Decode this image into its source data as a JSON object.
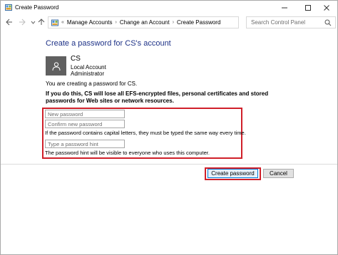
{
  "window": {
    "title": "Create Password"
  },
  "address": {
    "crumbs": [
      "Manage Accounts",
      "Change an Account",
      "Create Password"
    ],
    "overflow_glyph": "«"
  },
  "search": {
    "placeholder": "Search Control Panel"
  },
  "content": {
    "title": "Create a password for CS's account",
    "account": {
      "name": "CS",
      "type": "Local Account",
      "role": "Administrator"
    },
    "creating_note": "You are creating a password for CS.",
    "warning": "If you do this, CS will lose all EFS-encrypted files, personal certificates and stored passwords for Web sites or network resources."
  },
  "form": {
    "new_password_placeholder": "New password",
    "confirm_password_placeholder": "Confirm new password",
    "caps_note": "If the password contains capital letters, they must be typed the same way every time.",
    "hint_placeholder": "Type a password hint",
    "hint_note": "The password hint will be visible to everyone who uses this computer."
  },
  "buttons": {
    "create": "Create password",
    "cancel": "Cancel"
  },
  "colors": {
    "accent_title": "#1e3287",
    "highlight_red": "#d0202a",
    "avatar_gray": "#606060",
    "primary_button_border": "#0078d7"
  },
  "icons": {
    "app": "control-panel-icon",
    "back": "back-arrow-icon",
    "forward": "forward-arrow-icon",
    "recent": "chevron-down-icon",
    "up": "up-arrow-icon",
    "refresh": "refresh-icon",
    "search": "search-icon",
    "avatar": "user-avatar-icon"
  }
}
